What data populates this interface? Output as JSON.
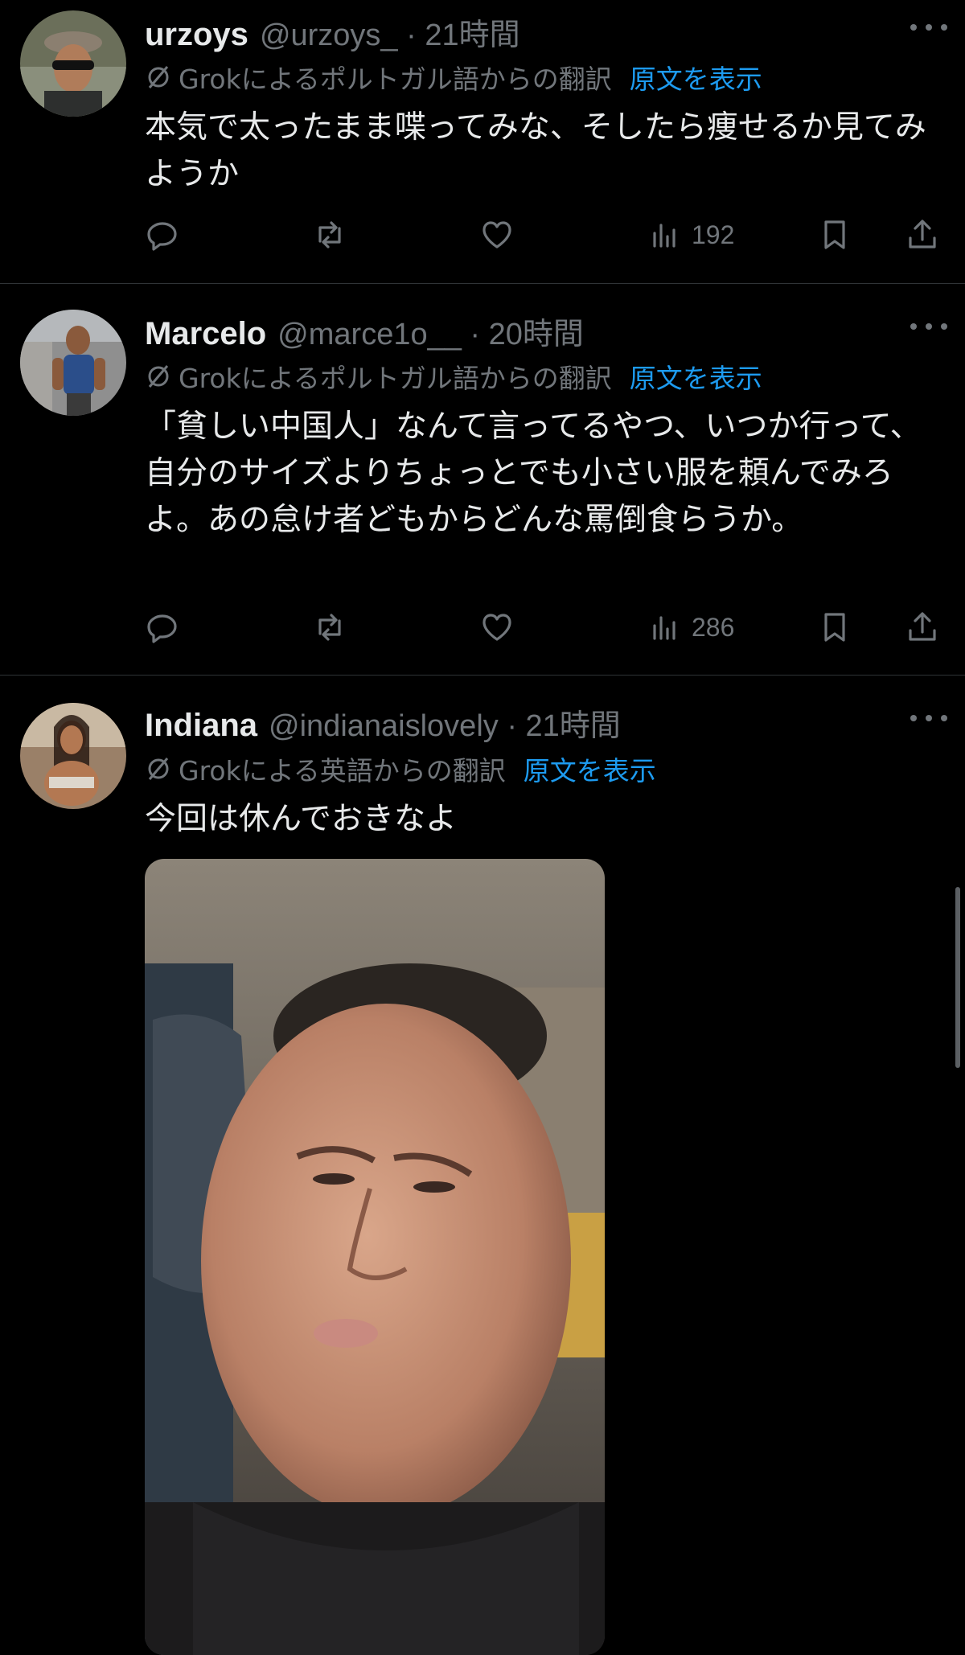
{
  "translate_icon": "translate-icon",
  "colors": {
    "background": "#000000",
    "text": "#e7e9ea",
    "secondary": "#71767b",
    "link": "#1d9bf0",
    "divider": "#2f3336"
  },
  "tweets": [
    {
      "name": "urzoys",
      "handle": "@urzoys_ · 21時間",
      "translation": "Grokによるポルトガル語からの翻訳",
      "show_original": "原文を表示",
      "text": "本気で太ったまま喋ってみな、そしたら痩せるか見てみようか",
      "views": "192"
    },
    {
      "name": "Marcelo",
      "handle": "@marce1o__ · 20時間",
      "translation": "Grokによるポルトガル語からの翻訳",
      "show_original": "原文を表示",
      "text": "「貧しい中国人」なんて言ってるやつ、いつか行って、自分のサイズよりちょっとでも小さい服を頼んでみろよ。あの怠け者どもからどんな罵倒食らうか。",
      "views": "286"
    },
    {
      "name": "Indiana",
      "handle": "@indianaislovely · 21時間",
      "translation": "Grokによる英語からの翻訳",
      "show_original": "原文を表示",
      "text": "今回は休んでおきなよ"
    }
  ]
}
